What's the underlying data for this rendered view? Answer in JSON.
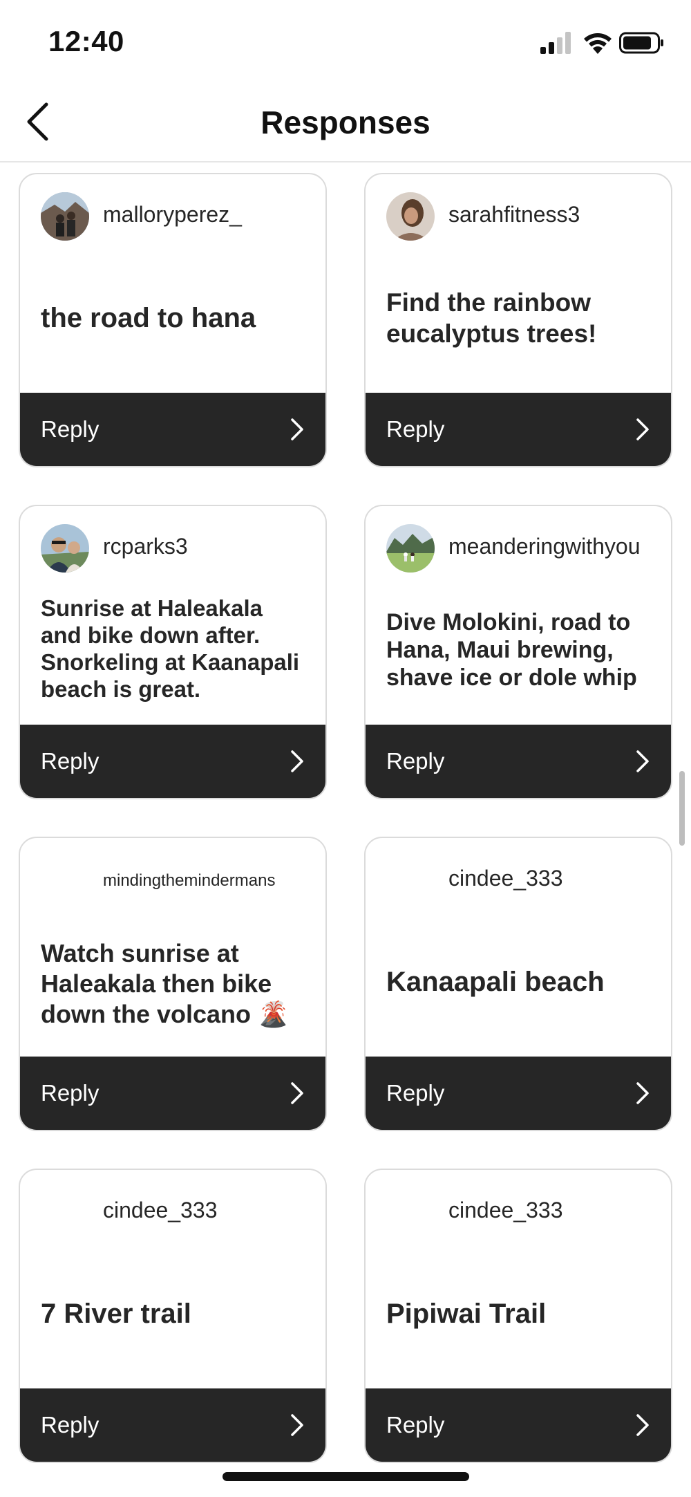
{
  "status_bar": {
    "time": "12:40"
  },
  "header": {
    "title": "Responses",
    "back_icon": "chevron-left-icon"
  },
  "colors": {
    "reply_bar": "#262626",
    "card_border": "#dbdbdb",
    "text": "#262626"
  },
  "cards": [
    {
      "username": "malloryperez_",
      "response": "the road to hana",
      "reply_label": "Reply",
      "has_avatar": true
    },
    {
      "username": "sarahfitness3",
      "response": "Find the rainbow eucalyptus trees!",
      "reply_label": "Reply",
      "has_avatar": true
    },
    {
      "username": "rcparks3",
      "response": "Sunrise at Haleakala and bike down after. Snorkeling at Kaanapali beach is great.",
      "reply_label": "Reply",
      "has_avatar": true
    },
    {
      "username": "meanderingwithyou",
      "response": "Dive Molokini, road to Hana, Maui brewing, shave ice or dole whip",
      "reply_label": "Reply",
      "has_avatar": true
    },
    {
      "username": "mindingthemindermans",
      "response": "Watch sunrise at Haleakala then bike down the volcano 🌋",
      "reply_label": "Reply",
      "has_avatar": false
    },
    {
      "username": "cindee_333",
      "response": "Kanaapali beach",
      "reply_label": "Reply",
      "has_avatar": false
    },
    {
      "username": "cindee_333",
      "response": "7 River trail",
      "reply_label": "Reply",
      "has_avatar": false
    },
    {
      "username": "cindee_333",
      "response": "Pipiwai Trail",
      "reply_label": "Reply",
      "has_avatar": false
    }
  ]
}
